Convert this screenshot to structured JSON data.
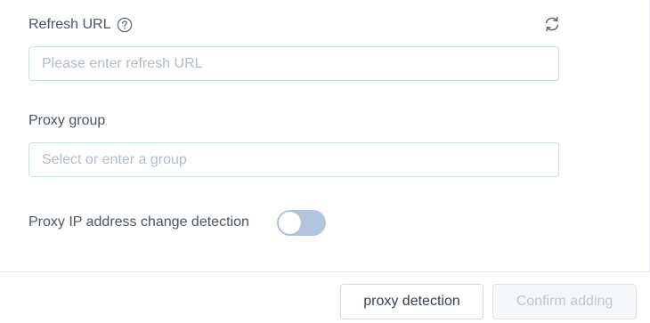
{
  "form": {
    "refresh_url": {
      "label": "Refresh URL",
      "placeholder": "Please enter refresh URL",
      "value": "",
      "help_icon": "question-circle-icon",
      "refresh_icon": "refresh-icon"
    },
    "proxy_group": {
      "label": "Proxy group",
      "placeholder": "Select or enter a group",
      "value": ""
    },
    "ip_change_detection": {
      "label": "Proxy IP address change detection",
      "enabled": false
    }
  },
  "footer": {
    "detect_label": "proxy detection",
    "confirm_label": "Confirm adding",
    "confirm_disabled": true
  },
  "colors": {
    "label_text": "#4b5563",
    "input_border": "#c8e0dc",
    "placeholder": "#b3bcc6",
    "toggle_off": "#b3c4df",
    "icon": "#5f6b7a",
    "disabled_text": "#c0c7cf"
  }
}
